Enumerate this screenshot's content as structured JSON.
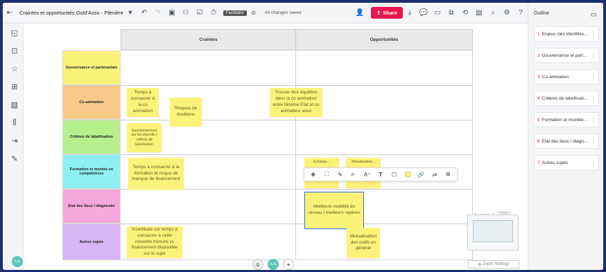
{
  "header": {
    "title": "Craintes et opportunités Gold'Asso - Plénière",
    "facilitator_badge": "Facilitator",
    "saved_status": "All changes saved",
    "share_label": "Share"
  },
  "board": {
    "columns": [
      "Craintes",
      "Opportunités"
    ],
    "rows": [
      {
        "label": "Gouvernance et partenariats",
        "color": "#fbf27a"
      },
      {
        "label": "Co-animation",
        "color": "#f9c98a"
      },
      {
        "label": "Critères de labellisation",
        "color": "#b7ef8f"
      },
      {
        "label": "Formation et montée en compétences",
        "color": "#8ef0f2"
      },
      {
        "label": "Etat des lieux / diagnostic",
        "color": "#f5a8dd"
      },
      {
        "label": "Autres sujets",
        "color": "#d7b4f3"
      }
    ],
    "stickies": [
      {
        "text": "Temps à consacrer à la co animation"
      },
      {
        "text": "Risques de doublons"
      },
      {
        "text": "Trouver bon équilibre dans la co animation entre binome Etat et co animateur asso"
      },
      {
        "text": "Questionnement sur les objectifs / critères de labellisation"
      },
      {
        "text": "Temps à consacrer à la formation et risque de manque de financement"
      },
      {
        "text": "Echange..."
      },
      {
        "text": "Mutualisation..."
      },
      {
        "text": "Meilleure visibilité du réseau / meilleurs repères"
      },
      {
        "text": "Incertitude sur temps à consacrer à cette nouvelle mesure vs financement disponible sur le sujet"
      },
      {
        "text": "Mutualisation des outils en général"
      }
    ]
  },
  "zoom": {
    "percent": "20%",
    "settings_label": "Zoom Settings"
  },
  "user": {
    "initials": "S.E"
  },
  "outline": {
    "title": "Outline",
    "items": [
      {
        "num": "1",
        "label": "Enjeux clés identifiés..."
      },
      {
        "num": "2",
        "label": "Gouvernance et part..."
      },
      {
        "num": "3",
        "label": "Co-animation"
      },
      {
        "num": "4",
        "label": "Critères de labellisati..."
      },
      {
        "num": "5",
        "label": "Formation et montée..."
      },
      {
        "num": "6",
        "label": "Etat des lieux / diagn..."
      },
      {
        "num": "7",
        "label": "Autres sujets"
      }
    ]
  }
}
